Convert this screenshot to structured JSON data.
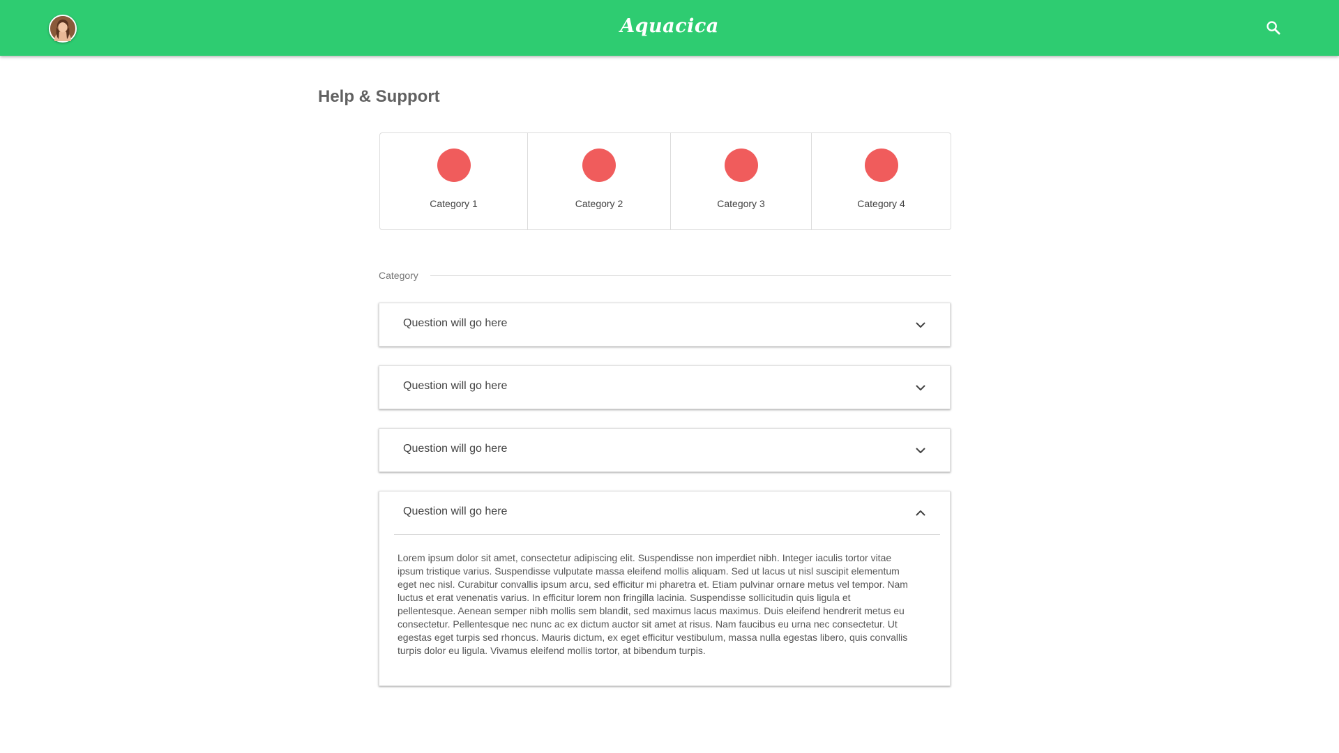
{
  "header": {
    "brand": "Aquacica",
    "avatar_icon": "user-avatar",
    "search_icon": "search-icon",
    "color": "#2ecc71"
  },
  "page": {
    "title": "Help & Support"
  },
  "categories": [
    {
      "label": "Category 1",
      "color": "#f05c5c"
    },
    {
      "label": "Category 2",
      "color": "#f05c5c"
    },
    {
      "label": "Category 3",
      "color": "#f05c5c"
    },
    {
      "label": "Category 4",
      "color": "#f05c5c"
    }
  ],
  "section": {
    "label": "Category"
  },
  "faqs": [
    {
      "question": "Question will go here",
      "expanded": false
    },
    {
      "question": "Question will go here",
      "expanded": false
    },
    {
      "question": "Question will go here",
      "expanded": false
    },
    {
      "question": "Question will go here",
      "expanded": true,
      "answer": "Lorem ipsum dolor sit amet, consectetur adipiscing elit. Suspendisse non imperdiet nibh. Integer iaculis tortor vitae ipsum tristique varius. Suspendisse vulputate massa eleifend mollis aliquam. Sed ut lacus ut nisl suscipit elementum eget nec nisl. Curabitur convallis ipsum arcu, sed efficitur mi pharetra et. Etiam pulvinar ornare metus vel tempor. Nam luctus et erat venenatis varius. In efficitur lorem non fringilla lacinia. Suspendisse sollicitudin quis ligula et pellentesque. Aenean semper nibh mollis sem blandit, sed maximus lacus maximus. Duis eleifend hendrerit metus eu consectetur. Pellentesque nec nunc ac ex dictum auctor sit amet at risus. Nam faucibus eu urna nec consectetur. Ut egestas eget turpis sed rhoncus. Mauris dictum, ex eget efficitur vestibulum, massa nulla egestas libero, quis convallis turpis dolor eu ligula. Vivamus eleifend mollis tortor, at bibendum turpis."
    }
  ]
}
